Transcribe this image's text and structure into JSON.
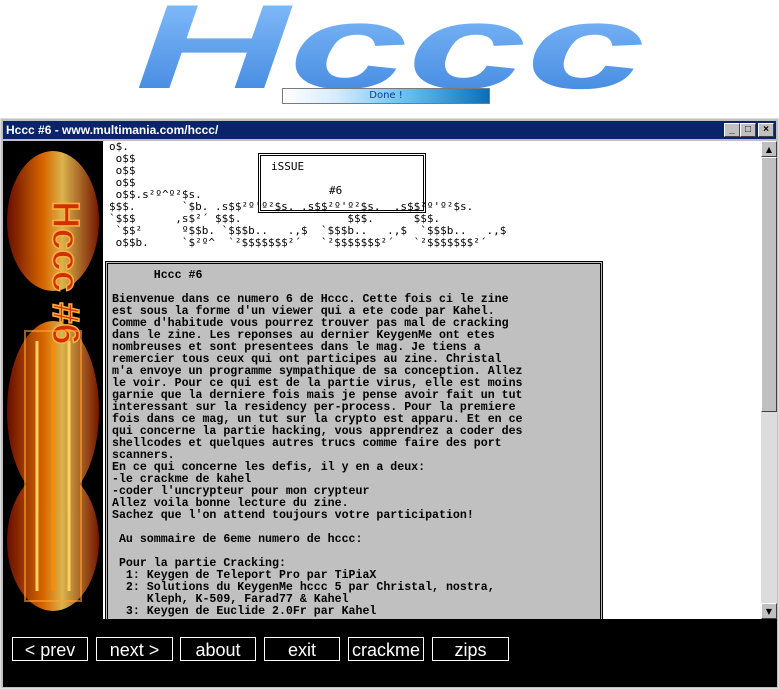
{
  "logo": {
    "text": "Hccc"
  },
  "progress": {
    "label": "Done !"
  },
  "window": {
    "title": "Hccc #6 - www.multimania.com/hccc/",
    "controls": {
      "minimize": "_",
      "maximize": "□",
      "close": "×"
    }
  },
  "sidebar": {
    "label": "Hccc #6"
  },
  "ascii": {
    "issue": "iSSUE",
    "number": "#6",
    "art": "o$.\n o$$\n o$$\n o$$\n o$$.s²º^º²$s.\n$$$.       `$b. .s$$²º'º²$s. .s$$²º'º²$s.  .s$$²º'º²$s.\n`$$$      ,s$²´ $$$.                $$$.      $$$.\n `$$²      º$$b. `$$$b..   .,$  `$$$b..   .,$  `$$$b..   .,$\n o$$b.     `$²º^  `²$$$$$$$²´   `²$$$$$$$²´   `²$$$$$$$²´"
  },
  "doc": {
    "heading": "Hccc #6",
    "lines": [
      "Bienvenue dans ce numero 6 de Hccc. Cette fois ci le zine",
      "est sous la forme d'un viewer qui a ete code par Kahel.",
      "Comme d'habitude vous pourrez trouver pas mal de cracking",
      "dans le zine. Les reponses au dernier KeygenMe ont etes",
      "nombreuses et sont presentees dans le mag. Je tiens a",
      "remercier tous ceux qui ont participes au zine. Christal",
      "m'a envoye un programme sympathique de sa conception. Allez",
      "le voir. Pour ce qui est de la partie virus, elle est moins",
      "garnie que la derniere fois mais je pense avoir fait un tut",
      "interessant sur la residency per-process. Pour la premiere",
      "fois dans ce mag, un tut sur la crypto est apparu. Et en ce",
      "qui concerne la partie hacking, vous apprendrez a coder des",
      "shellcodes et quelques autres trucs comme faire des port",
      "scanners.",
      "En ce qui concerne les defis, il y en a deux:",
      "-le crackme de kahel",
      "-coder l'uncrypteur pour mon crypteur",
      "Allez voila bonne lecture du zine.",
      "Sachez que l'on attend toujours votre participation!",
      "",
      " Au sommaire de 6eme numero de hccc:",
      "",
      " Pour la partie Cracking:",
      "  1: Keygen de Teleport Pro par TiPiaX",
      "  2: Solutions du KeygenMe hccc 5 par Christal, nostra,",
      "     Kleph, K-509, Farad77 & Kahel",
      "  3: Keygen de Euclide 2.0Fr par Kahel"
    ]
  },
  "nav": {
    "prev": "< prev",
    "next": "next >",
    "about": "about",
    "exit": "exit",
    "crackme": "crackme",
    "zips": "zips"
  },
  "colors": {
    "titlebar": "#0a246a",
    "logo": "#5aa0e8",
    "sidebar_fire": "#ff8a00"
  }
}
